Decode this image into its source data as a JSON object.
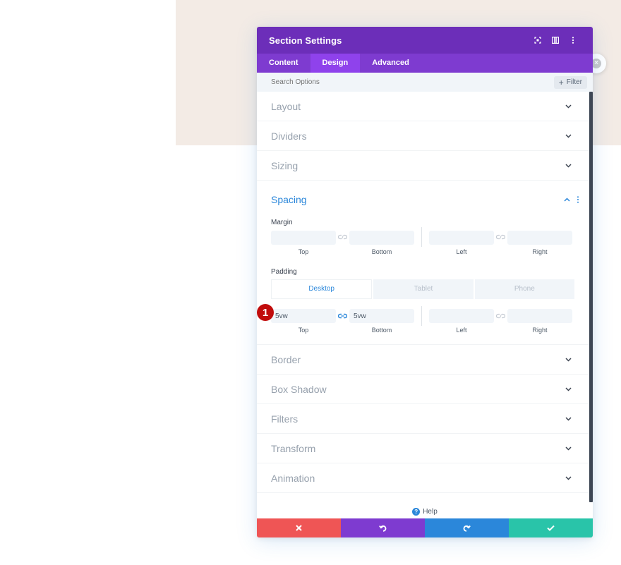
{
  "modal": {
    "title": "Section Settings",
    "tabs": [
      "Content",
      "Design",
      "Advanced"
    ],
    "active_tab": "Design",
    "search_placeholder": "Search Options",
    "filter_label": "Filter"
  },
  "groups_before": [
    "Layout",
    "Dividers",
    "Sizing"
  ],
  "spacing": {
    "title": "Spacing",
    "margin_label": "Margin",
    "margin": {
      "top": "",
      "bottom": "",
      "left": "",
      "right": ""
    },
    "padding_label": "Padding",
    "device_tabs": [
      "Desktop",
      "Tablet",
      "Phone"
    ],
    "active_device": "Desktop",
    "padding": {
      "top": "5vw",
      "bottom": "5vw",
      "left": "",
      "right": ""
    },
    "side_labels": {
      "top": "Top",
      "bottom": "Bottom",
      "left": "Left",
      "right": "Right"
    },
    "marker_number": "1"
  },
  "groups_after": [
    "Border",
    "Box Shadow",
    "Filters",
    "Transform",
    "Animation"
  ],
  "help_label": "Help",
  "colors": {
    "header": "#6c2eb9",
    "tabs": "#7e3bd0",
    "active_tab": "#8f42ec",
    "accent": "#2b87da",
    "cancel": "#ef5555",
    "undo": "#7e3bd0",
    "redo": "#2b87da",
    "save": "#29c4a9",
    "marker": "#c10c0c"
  },
  "icons": {
    "header": [
      "expand-icon",
      "split-view-icon",
      "more-vertical-icon"
    ],
    "footer": [
      "close-icon",
      "undo-icon",
      "redo-icon",
      "checkmark-icon"
    ]
  }
}
